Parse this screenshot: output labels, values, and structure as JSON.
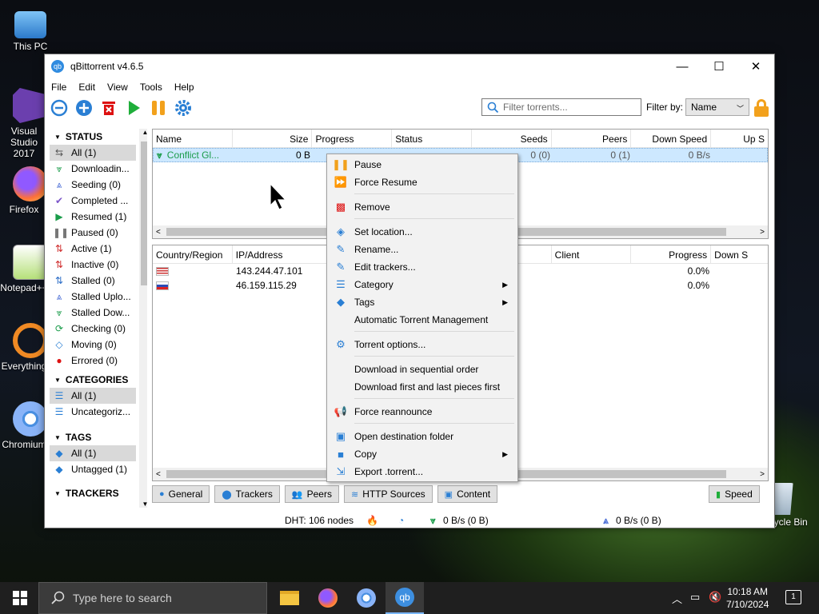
{
  "desktop": {
    "icons": [
      "This PC",
      "Visual Studio 2017",
      "Firefox",
      "Notepad++",
      "Everything",
      "Chromium",
      "Recycle Bin"
    ]
  },
  "window": {
    "title": "qBittorrent v4.6.5",
    "minimize": "—",
    "maximize": "☐",
    "close": "✕"
  },
  "menu": [
    "File",
    "Edit",
    "View",
    "Tools",
    "Help"
  ],
  "toolbar": {
    "filter_placeholder": "Filter torrents...",
    "filter_by": "Filter by:",
    "filter_value": "Name"
  },
  "sidebar": {
    "status_header": "STATUS",
    "status_items": [
      {
        "label": "All (1)",
        "icon": "⇆",
        "color": "#555"
      },
      {
        "label": "Downloadin...",
        "icon": "⩔",
        "color": "#1a9c4a"
      },
      {
        "label": "Seeding (0)",
        "icon": "⩓",
        "color": "#4c6fd6"
      },
      {
        "label": "Completed ...",
        "icon": "✔",
        "color": "#7b55c9"
      },
      {
        "label": "Resumed (1)",
        "icon": "▶",
        "color": "#1a9c4a"
      },
      {
        "label": "Paused (0)",
        "icon": "❚❚",
        "color": "#777"
      },
      {
        "label": "Active (1)",
        "icon": "⇅",
        "color": "#d03030"
      },
      {
        "label": "Inactive (0)",
        "icon": "⇅",
        "color": "#d03030"
      },
      {
        "label": "Stalled (0)",
        "icon": "⇅",
        "color": "#3070c8"
      },
      {
        "label": "Stalled Uplo...",
        "icon": "⩓",
        "color": "#4c6fd6"
      },
      {
        "label": "Stalled Dow...",
        "icon": "⩔",
        "color": "#1a9c4a"
      },
      {
        "label": "Checking (0)",
        "icon": "⟳",
        "color": "#1a9c4a"
      },
      {
        "label": "Moving (0)",
        "icon": "◇",
        "color": "#2a7fd4"
      },
      {
        "label": "Errored (0)",
        "icon": "●",
        "color": "#d11"
      }
    ],
    "categories_header": "CATEGORIES",
    "category_items": [
      {
        "label": "All (1)",
        "icon": "☰"
      },
      {
        "label": "Uncategoriz...",
        "icon": "☰"
      }
    ],
    "tags_header": "TAGS",
    "tag_items": [
      {
        "label": "All (1)",
        "icon": "◆"
      },
      {
        "label": "Untagged (1)",
        "icon": "◆"
      }
    ],
    "trackers_header": "TRACKERS"
  },
  "torrents": {
    "headers": [
      "Name",
      "Size",
      "Progress",
      "Status",
      "Seeds",
      "Peers",
      "Down Speed",
      "Up S"
    ],
    "row": {
      "name": "Conflict Gl...",
      "size": "0 B",
      "seeds": "0 (0)",
      "peers": "0 (1)",
      "down": "0 B/s"
    }
  },
  "peers": {
    "headers": [
      "Country/Region",
      "IP/Address",
      "Client",
      "Progress",
      "Down S"
    ],
    "rows": [
      {
        "ip": "143.244.47.101",
        "progress": "0.0%",
        "flag": "us"
      },
      {
        "ip": "46.159.115.29",
        "progress": "0.0%",
        "flag": "ru"
      }
    ]
  },
  "tabs": [
    "General",
    "Trackers",
    "Peers",
    "HTTP Sources",
    "Content",
    "Speed"
  ],
  "statusbar": {
    "dht": "DHT: 106 nodes",
    "down": "0 B/s (0 B)",
    "up": "0 B/s (0 B)"
  },
  "context_menu": {
    "items": [
      "Pause",
      "Force Resume",
      "Remove",
      "Set location...",
      "Rename...",
      "Edit trackers...",
      "Category",
      "Tags",
      "Automatic Torrent Management",
      "Torrent options...",
      "Download in sequential order",
      "Download first and last pieces first",
      "Force reannounce",
      "Open destination folder",
      "Copy",
      "Export .torrent..."
    ]
  },
  "taskbar": {
    "search_placeholder": "Type here to search",
    "time": "10:18 AM",
    "date": "7/10/2024",
    "notif": "1"
  }
}
